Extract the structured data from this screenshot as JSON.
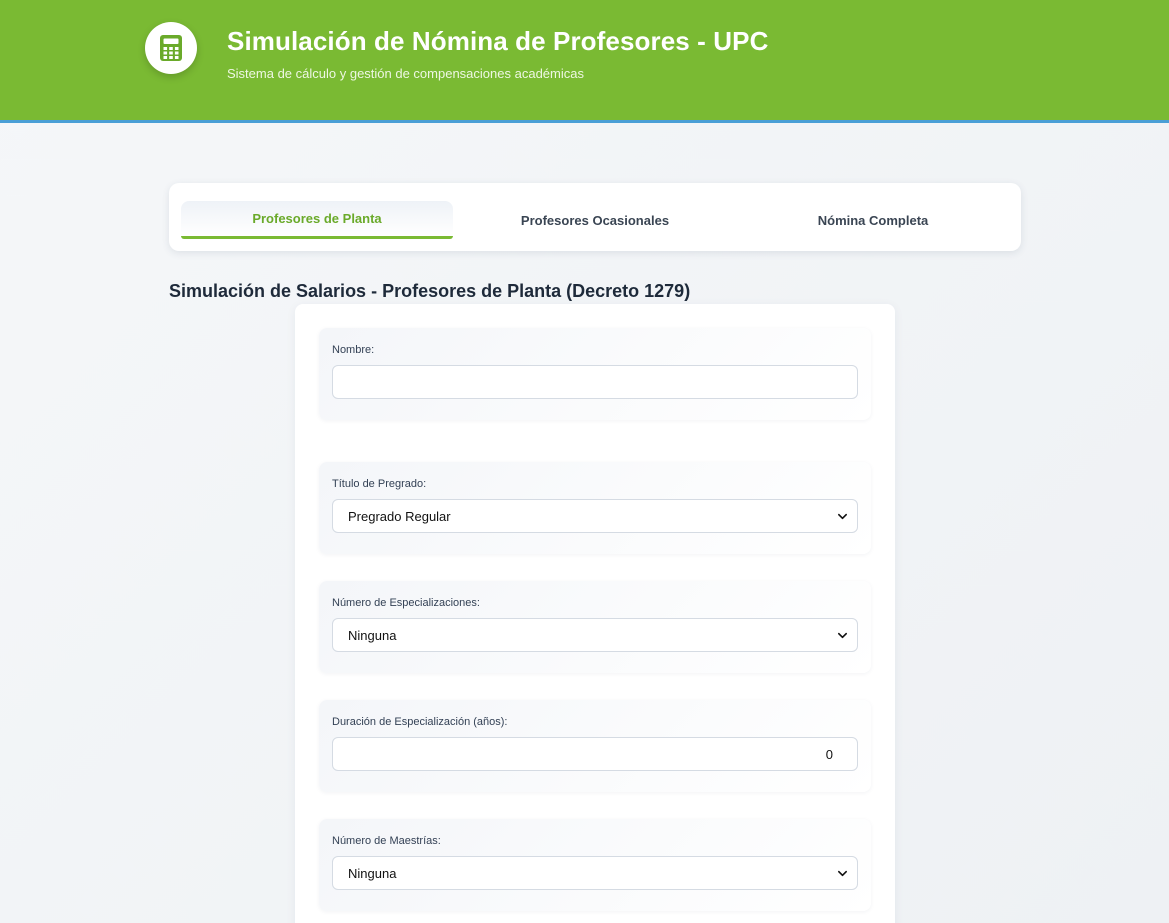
{
  "header": {
    "title": "Simulación de Nómina de Profesores - UPC",
    "subtitle": "Sistema de cálculo y gestión de compensaciones académicas",
    "logo_icon": "calculator-icon",
    "brand_color": "#7aba33",
    "accent_color": "#4a9fd6"
  },
  "tabs": [
    {
      "label": "Profesores de Planta",
      "active": true
    },
    {
      "label": "Profesores Ocasionales",
      "active": false
    },
    {
      "label": "Nómina Completa",
      "active": false
    }
  ],
  "section": {
    "title": "Simulación de Salarios - Profesores de Planta (Decreto 1279)"
  },
  "form": {
    "nombre": {
      "label": "Nombre:",
      "value": "",
      "placeholder": ""
    },
    "titulo_pregrado": {
      "label": "Título de Pregrado:",
      "selected": "Pregrado Regular"
    },
    "num_especializaciones": {
      "label": "Número de Especializaciones:",
      "selected": "Ninguna"
    },
    "duracion_especializacion": {
      "label": "Duración de Especialización (años):",
      "value": "0"
    },
    "num_maestrias": {
      "label": "Número de Maestrías:",
      "selected": "Ninguna"
    }
  }
}
